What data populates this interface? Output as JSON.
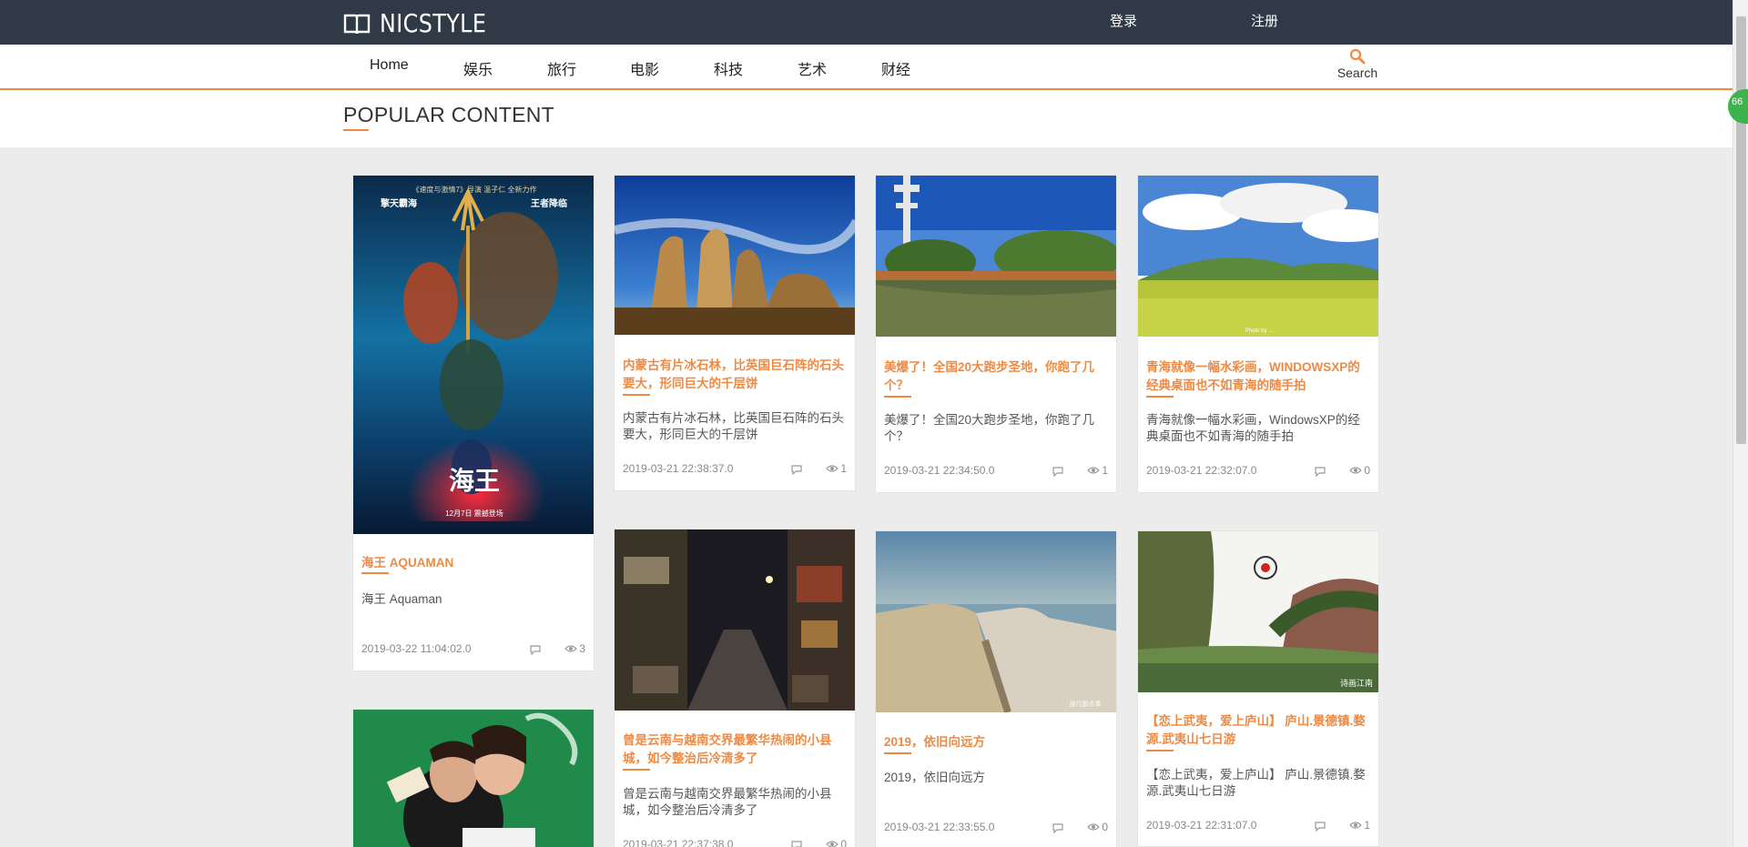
{
  "brand": {
    "name": "NICSTYLE",
    "icon": "open-book-icon"
  },
  "top_links": {
    "login": "登录",
    "register": "注册"
  },
  "nav": {
    "items": [
      "Home",
      "娱乐",
      "旅行",
      "电影",
      "科技",
      "艺术",
      "财经"
    ],
    "search_label": "Search"
  },
  "section": {
    "title": "POPULAR CONTENT"
  },
  "colors": {
    "accent": "#ef8a43",
    "topbar": "#2f3a46",
    "page_bg": "#ececec"
  },
  "cards": [
    {
      "title": "海王 AQUAMAN",
      "desc": "海王 Aquaman",
      "date": "2019-03-22 11:04:02.0",
      "views": "3"
    },
    {
      "title": "内蒙古有片冰石林，比英国巨石阵的石头要大，形同巨大的千层饼",
      "desc": "内蒙古有片冰石林，比英国巨石阵的石头要大，形同巨大的千层饼",
      "date": "2019-03-21 22:38:37.0",
      "views": "1"
    },
    {
      "title": "美爆了！全国20大跑步圣地，你跑了几个？",
      "desc": "美爆了！全国20大跑步圣地，你跑了几个？",
      "date": "2019-03-21 22:34:50.0",
      "views": "1"
    },
    {
      "title": "青海就像一幅水彩画，WINDOWSXP的经典桌面也不如青海的随手拍",
      "desc": "青海就像一幅水彩画，WindowsXP的经典桌面也不如青海的随手拍",
      "date": "2019-03-21 22:32:07.0",
      "views": "0"
    },
    {
      "title": "曾是云南与越南交界最繁华热闹的小县城，如今整治后冷清多了",
      "desc": "曾是云南与越南交界最繁华热闹的小县城，如今整治后冷清多了",
      "date": "2019-03-21 22:37:38.0",
      "views": "0"
    },
    {
      "title": "2019，依旧向远方",
      "desc": "2019，依旧向远方",
      "date": "2019-03-21 22:33:55.0",
      "views": "0"
    },
    {
      "title": "【恋上武夷，爱上庐山】 庐山.景德镇.婺源.武夷山七日游",
      "desc": "【恋上武夷，爱上庐山】 庐山.景德镇.婺源.武夷山七日游",
      "date": "2019-03-21 22:31:07.0",
      "views": "1"
    }
  ],
  "image_texts": {
    "aquaman_poster": {
      "top": "《速度与激情7》导演 温子仁 全新力作",
      "left": "擎天霸海",
      "right": "王者降临",
      "title": "海王",
      "date": "12月7日 震撼登场"
    },
    "qinghai_caption": "Photo by ...",
    "travel_caption": "旅行那点事",
    "wuyi_caption": "诗画江南"
  },
  "scroll_badge": "66"
}
